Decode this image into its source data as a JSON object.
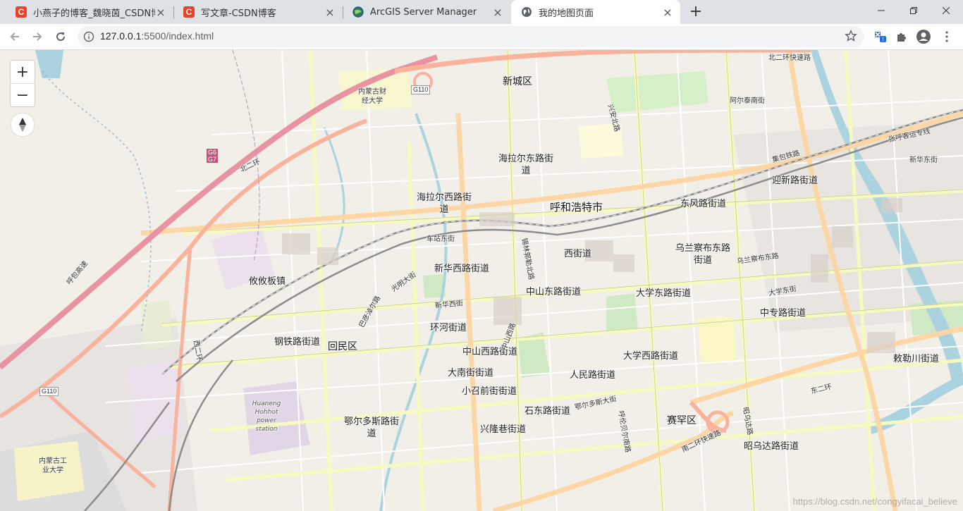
{
  "browser": {
    "tabs": [
      {
        "title": "小燕子的博客_魏晓茵_CSDN博客",
        "favicon": "csdn-icon",
        "active": false
      },
      {
        "title": "写文章-CSDN博客",
        "favicon": "csdn-icon",
        "active": false
      },
      {
        "title": "ArcGIS Server Manager",
        "favicon": "arcgis-globe-icon",
        "active": false
      },
      {
        "title": "我的地图页面",
        "favicon": "globe-icon",
        "active": true
      }
    ],
    "new_tab_label": "+",
    "address": {
      "host": "127.0.0.1",
      "path": ":5500/index.html"
    }
  },
  "map": {
    "controls": {
      "zoom_in": "+",
      "zoom_out": "−"
    },
    "district_labels": [
      "新城区",
      "海拉尔东路街道",
      "海拉尔西路街道",
      "呼和浩特市",
      "东风路街道",
      "迎新路街道",
      "西街道",
      "乌兰察布东路街道",
      "新华西路街道",
      "攸攸板镇",
      "中山东路街道",
      "大学东路街道",
      "中专路街道",
      "环河街道",
      "钢铁路街道",
      "回民区",
      "中山西路街道",
      "大学西路街道",
      "敕勒川街道",
      "大南街街道",
      "人民路街道",
      "小召前街街道",
      "石东路街道",
      "赛罕区",
      "鄂尔多斯路街道",
      "兴隆巷街道",
      "昭乌达路街道"
    ],
    "poi_labels": [
      "内蒙古财经大学",
      "内蒙古工业大学"
    ],
    "station_label": "Huaneng Hohhot power station",
    "road_labels": [
      "北二环快速路",
      "呼包高速",
      "北二环",
      "新华东街",
      "锡林郭勒北路",
      "巴彦淖尔路",
      "集包铁路",
      "张呼客运专线",
      "乌兰察布东路",
      "大学东街",
      "鄂尔多斯大街",
      "东二环",
      "南二环快速路",
      "西二环",
      "新华西街",
      "光明大街",
      "中山西路",
      "兴安北路",
      "车站东街",
      "呼伦贝尔南路",
      "阿尔泰南街",
      "昭乌达路"
    ],
    "route_shields": [
      "G110",
      "G6",
      "G7"
    ],
    "watermark": "https://blog.csdn.net/congyifacai_believe"
  }
}
